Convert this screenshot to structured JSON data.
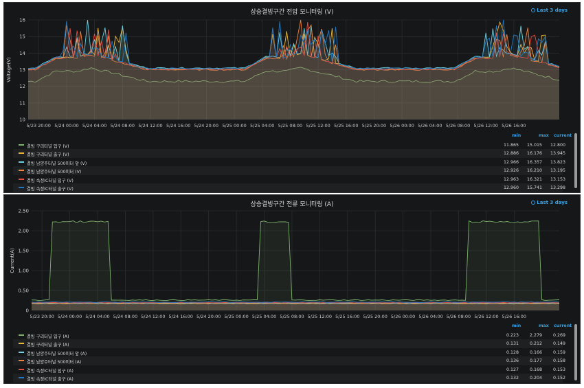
{
  "chart_data": [
    {
      "type": "line",
      "title": "상승결빙구간 전압 모니터링 (V)",
      "time_range": "Last 3 days",
      "ylabel": "Voltage(V)",
      "ylim": [
        10,
        16
      ],
      "yticks": [
        "16",
        "15",
        "14",
        "13",
        "12",
        "11",
        "10"
      ],
      "x_tick_labels": [
        "5/23 20:00",
        "5/24 00:00",
        "5/24 04:00",
        "5/24 08:00",
        "5/24 12:00",
        "5/24 16:00",
        "5/24 20:00",
        "5/25 00:00",
        "5/25 04:00",
        "5/25 08:00",
        "5/25 12:00",
        "5/25 16:00",
        "5/25 20:00",
        "5/26 00:00",
        "5/26 04:00",
        "5/26 08:00",
        "5/26 12:00",
        "5/26 16:00"
      ],
      "legend_columns": [
        "min",
        "max",
        "current"
      ],
      "series": [
        {
          "name": "결빙 구리터널 입구 (V)",
          "color": "#7eb26d",
          "min": "11.865",
          "max": "15.015",
          "current": "12.800"
        },
        {
          "name": "결빙 구리터널 출구 (V)",
          "color": "#eab839",
          "min": "12.886",
          "max": "16.176",
          "current": "13.945"
        },
        {
          "name": "결빙 남양주터널 500미터 앞 (V)",
          "color": "#6ed0e0",
          "min": "12.966",
          "max": "16.357",
          "current": "13.823"
        },
        {
          "name": "결빙 남양주터널 500미터 (V)",
          "color": "#ef843c",
          "min": "12.926",
          "max": "16.210",
          "current": "13.195"
        },
        {
          "name": "결빙 속정IC터널 입구 (V)",
          "color": "#e24d42",
          "min": "12.963",
          "max": "16.321",
          "current": "13.153"
        },
        {
          "name": "결빙 속정IC터널 출구 (V)",
          "color": "#1f78c1",
          "min": "12.960",
          "max": "15.741",
          "current": "13.298"
        }
      ]
    },
    {
      "type": "line",
      "title": "상승결빙구간 전류 모니터링 (A)",
      "time_range": "Last 3 days",
      "ylabel": "Current(A)",
      "ylim": [
        0,
        2.5
      ],
      "yticks": [
        "2.50",
        "2.00",
        "1.50",
        "1.00",
        "0.50",
        "0"
      ],
      "x_tick_labels": [
        "5/23 20:00",
        "5/24 00:00",
        "5/24 04:00",
        "5/24 08:00",
        "5/24 12:00",
        "5/24 16:00",
        "5/24 20:00",
        "5/25 00:00",
        "5/25 04:00",
        "5/25 08:00",
        "5/25 12:00",
        "5/25 16:00",
        "5/25 20:00",
        "5/26 00:00",
        "5/26 04:00",
        "5/26 08:00",
        "5/26 12:00",
        "5/26 16:00"
      ],
      "legend_columns": [
        "min",
        "max",
        "current"
      ],
      "series": [
        {
          "name": "결빙 구리터널 입구 (A)",
          "color": "#7eb26d",
          "min": "0.223",
          "max": "2.279",
          "current": "0.269"
        },
        {
          "name": "결빙 구리터널 출구 (A)",
          "color": "#eab839",
          "min": "0.131",
          "max": "0.212",
          "current": "0.149"
        },
        {
          "name": "결빙 남양주터널 500미터 앞 (A)",
          "color": "#6ed0e0",
          "min": "0.128",
          "max": "0.166",
          "current": "0.159"
        },
        {
          "name": "결빙 남양주터널 500미터 (A)",
          "color": "#ef843c",
          "min": "0.136",
          "max": "0.177",
          "current": "0.158"
        },
        {
          "name": "결빙 속정IC터널 입구 (A)",
          "color": "#e24d42",
          "min": "0.127",
          "max": "0.168",
          "current": "0.153"
        },
        {
          "name": "결빙 속정IC터널 출구 (A)",
          "color": "#1f78c1",
          "min": "0.132",
          "max": "0.204",
          "current": "0.152"
        }
      ]
    }
  ]
}
